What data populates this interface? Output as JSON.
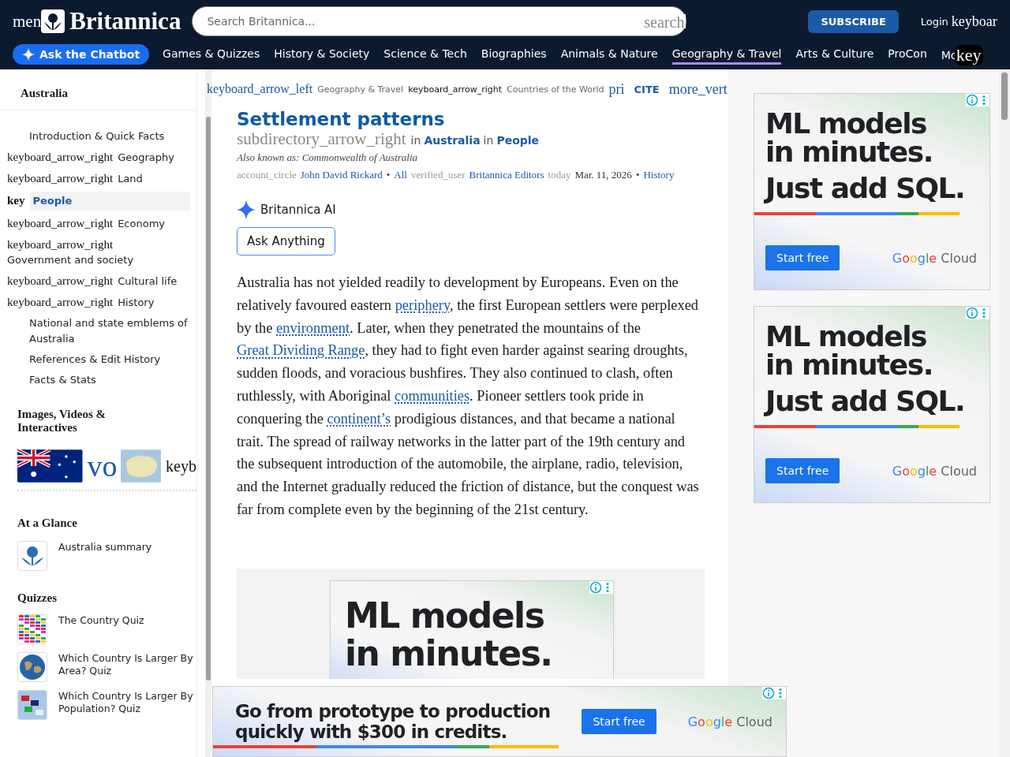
{
  "header": {
    "menu_icon_text": "men",
    "logo": "Britannica",
    "search": {
      "placeholder": "Search Britannica...",
      "icon_text": "search"
    },
    "subscribe": "SUBSCRIBE",
    "login": "Login",
    "login_icon_text": "keyboar",
    "chatbot": "Ask the Chatbot",
    "nav": [
      {
        "label": "Games & Quizzes",
        "selected": false
      },
      {
        "label": "History & Society",
        "selected": false
      },
      {
        "label": "Science & Tech",
        "selected": false
      },
      {
        "label": "Biographies",
        "selected": false
      },
      {
        "label": "Animals & Nature",
        "selected": false
      },
      {
        "label": "Geography & Travel",
        "selected": true
      },
      {
        "label": "Arts & Culture",
        "selected": false
      },
      {
        "label": "ProCon",
        "selected": false
      },
      {
        "label": "Mc",
        "selected": false
      }
    ],
    "nav_overflow_icon_text": "key"
  },
  "sidebar": {
    "title": "Australia",
    "toc": [
      {
        "label": "Introduction & Quick Facts",
        "selected": false
      },
      {
        "label": "Geography",
        "icon_text": "keyboard_arrow_right",
        "selected": false
      },
      {
        "label": "Land",
        "icon_text": "keyboard_arrow_right",
        "selected": false
      },
      {
        "label": "People",
        "icon_text": "key",
        "selected": true
      },
      {
        "label": "Economy",
        "icon_text": "keyboard_arrow_right",
        "selected": false
      },
      {
        "label": "Government and society",
        "icon_text": "keyboard_arrow_right",
        "selected": false
      },
      {
        "label": "Cultural life",
        "icon_text": "keyboard_arrow_right",
        "selected": false
      },
      {
        "label": "History",
        "icon_text": "keyboard_arrow_right",
        "selected": false
      },
      {
        "label": "National and state emblems of Australia",
        "selected": false
      },
      {
        "label": "References & Edit History",
        "selected": false
      },
      {
        "label": "Facts & Stats",
        "selected": false
      }
    ],
    "media": {
      "title": "Images, Videos & Interactives",
      "items": [
        {
          "kind": "flag"
        },
        {
          "kind": "text",
          "text": "vo"
        },
        {
          "kind": "map"
        },
        {
          "kind": "circle",
          "text": "keyb"
        }
      ]
    },
    "glance": {
      "title": "At a Glance",
      "items": [
        {
          "label": "Australia summary",
          "kind": "emblem"
        }
      ]
    },
    "quizzes": {
      "title": "Quizzes",
      "items": [
        {
          "label": "The Country Quiz",
          "kind": "flags"
        },
        {
          "label": "Which Country Is Larger By Area? Quiz",
          "kind": "globe"
        },
        {
          "label": "Which Country Is Larger By Population? Quiz",
          "kind": "flagpoles"
        }
      ]
    }
  },
  "article": {
    "back_icon_text": "keyboard_arrow_left",
    "breadcrumb": [
      "Geography & Travel",
      "Countries of the World"
    ],
    "breadcrumb_separator": "keyboard_arrow_right",
    "actions": [
      "pri",
      "CITE",
      "more_vert"
    ],
    "title": "Settlement patterns",
    "subtitle_icon_text": "subdirectory_arrow_right",
    "subtitle": [
      {
        "text": "in",
        "link": false
      },
      {
        "text": "Australia",
        "link": true
      },
      {
        "text": "in",
        "link": false
      },
      {
        "text": "People",
        "link": true
      }
    ],
    "aka": "Also known as: Commonwealth of Australia",
    "byline": [
      {
        "kind": "icon",
        "text": "account_circle"
      },
      {
        "kind": "link",
        "text": "John David Rickard"
      },
      {
        "kind": "plain",
        "text": "•"
      },
      {
        "kind": "link",
        "text": "All"
      },
      {
        "kind": "icon",
        "text": "verified_user"
      },
      {
        "kind": "link",
        "text": "Britannica Editors"
      },
      {
        "kind": "icon",
        "text": "today"
      },
      {
        "kind": "plain",
        "text": "Mar. 11, 2026"
      },
      {
        "kind": "plain",
        "text": "•"
      },
      {
        "kind": "link",
        "text": "History"
      }
    ],
    "ai_label": "Britannica AI",
    "ask_button": "Ask Anything",
    "paragraph": [
      {
        "text": "Australia has not yielded readily to development by Europeans. Even on the relatively favoured eastern ",
        "link": false
      },
      {
        "text": "periphery",
        "link": true
      },
      {
        "text": ", the first European settlers were perplexed by the ",
        "link": false
      },
      {
        "text": "environment",
        "link": true
      },
      {
        "text": ". Later, when they penetrated the mountains of the ",
        "link": false
      },
      {
        "text": "Great Dividing Range",
        "link": true
      },
      {
        "text": ", they had to fight even harder against searing droughts, sudden floods, and voracious bushfires. They also continued to clash, often ruthlessly, with Aboriginal ",
        "link": false
      },
      {
        "text": "communities",
        "link": true
      },
      {
        "text": ". Pioneer settlers took pride in conquering the ",
        "link": false
      },
      {
        "text": "continent’s",
        "link": true
      },
      {
        "text": " prodigious distances, and that became a national trait. The spread of railway networks in the latter part of the 19th century and the subsequent introduction of the automobile, the airplane, radio, television, and the Internet gradually reduced the friction of distance, but the conquest was far from complete even by the beginning of the 21st century.",
        "link": false
      }
    ],
    "inline_ad": {
      "headline": [
        "ML models",
        "in minutes."
      ]
    }
  },
  "side_ads": [
    {
      "headline": [
        "ML models",
        "in minutes.",
        "Just add SQL."
      ],
      "button": "Start free",
      "brand": "Google",
      "brand_suffix": "Cloud"
    },
    {
      "headline": [
        "ML models",
        "in minutes.",
        "Just add SQL."
      ],
      "button": "Start free",
      "brand": "Google",
      "brand_suffix": "Cloud"
    }
  ],
  "sticky_ad": {
    "headline": [
      "Go from prototype to production",
      "quickly with $300 in credits."
    ],
    "button": "Start free",
    "brand": "Google",
    "brand_suffix": "Cloud"
  }
}
